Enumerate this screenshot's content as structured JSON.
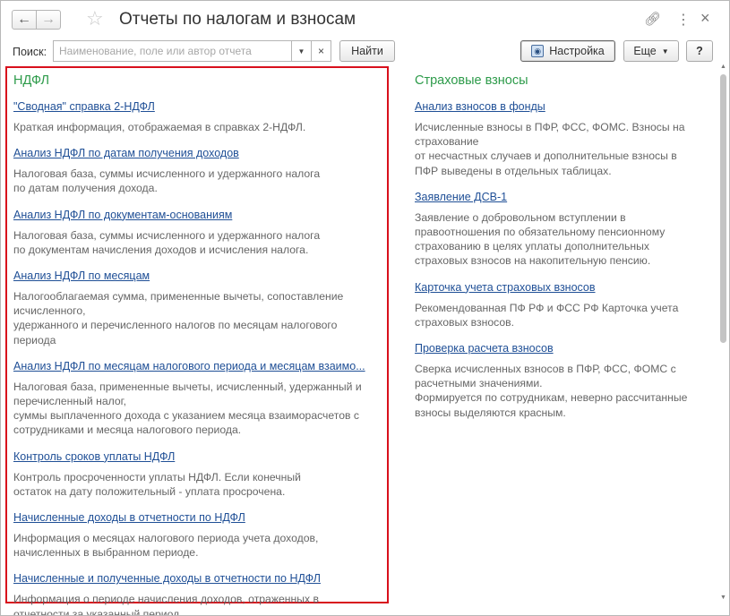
{
  "window": {
    "title": "Отчеты по налогам и взносам",
    "icons": {
      "back": "arrow-left-icon",
      "forward": "arrow-right-icon",
      "favorite": "star-icon",
      "link": "link-icon",
      "more": "vertical-dots-icon",
      "close": "close-icon"
    }
  },
  "toolbar": {
    "search_label": "Поиск:",
    "search_placeholder": "Наименование, поле или автор отчета",
    "search_value": "",
    "find_label": "Найти",
    "settings_label": "Настройка",
    "more_label": "Еще",
    "help_label": "?"
  },
  "left": {
    "title": "НДФЛ",
    "items": [
      {
        "link": "\"Сводная\" справка 2-НДФЛ",
        "desc": "Краткая информация, отображаемая в справках 2-НДФЛ."
      },
      {
        "link": "Анализ НДФЛ по датам получения доходов",
        "desc": "Налоговая база, суммы исчисленного и удержанного налога\nпо датам получения дохода."
      },
      {
        "link": "Анализ НДФЛ по документам-основаниям",
        "desc": "Налоговая база, суммы исчисленного и удержанного налога\nпо документам начисления доходов и исчисления налога."
      },
      {
        "link": "Анализ НДФЛ по месяцам",
        "desc": "Налогооблагаемая сумма, примененные вычеты, сопоставление\nисчисленного,\nудержанного и перечисленного налогов по месяцам налогового\nпериода"
      },
      {
        "link": "Анализ НДФЛ по месяцам налогового периода и месяцам взаимо...",
        "desc": "Налоговая база, примененные вычеты, исчисленный, удержанный и\nперечисленный налог,\nсуммы выплаченного дохода с указанием месяца взаиморасчетов с\nсотрудниками и месяца налогового периода."
      },
      {
        "link": "Контроль сроков уплаты НДФЛ",
        "desc": "Контроль просроченности уплаты НДФЛ. Если конечный\nостаток на дату положительный - уплата просрочена."
      },
      {
        "link": "Начисленные доходы в отчетности по НДФЛ",
        "desc": "Информация о месяцах налогового периода учета доходов,\nначисленных в выбранном периоде."
      },
      {
        "link": "Начисленные и полученные доходы в отчетности по НДФЛ",
        "desc": "Информация о периоде начисления доходов, отраженных в\nотчетности за указанный период."
      }
    ]
  },
  "right": {
    "title": "Страховые взносы",
    "items": [
      {
        "link": "Анализ взносов в фонды",
        "desc": "Исчисленные взносы в ПФР, ФСС, ФОМС. Взносы на\nстрахование\nот несчастных случаев и дополнительные взносы в\nПФР выведены в отдельных таблицах."
      },
      {
        "link": "Заявление ДСВ-1",
        "desc": "Заявление о добровольном вступлении в\nправоотношения по обязательному пенсионному\nстрахованию в целях уплаты дополнительных\nстраховых взносов на накопительную пенсию."
      },
      {
        "link": "Карточка учета страховых взносов",
        "desc": "Рекомендованная ПФ РФ и ФСС РФ Карточка учета\nстраховых взносов."
      },
      {
        "link": "Проверка расчета взносов",
        "desc": "Сверка исчисленных взносов в ПФР, ФСС, ФОМС с\nрасчетными значениями.\nФормируется по сотрудникам, неверно рассчитанные\nвзносы выделяются красным."
      }
    ]
  }
}
